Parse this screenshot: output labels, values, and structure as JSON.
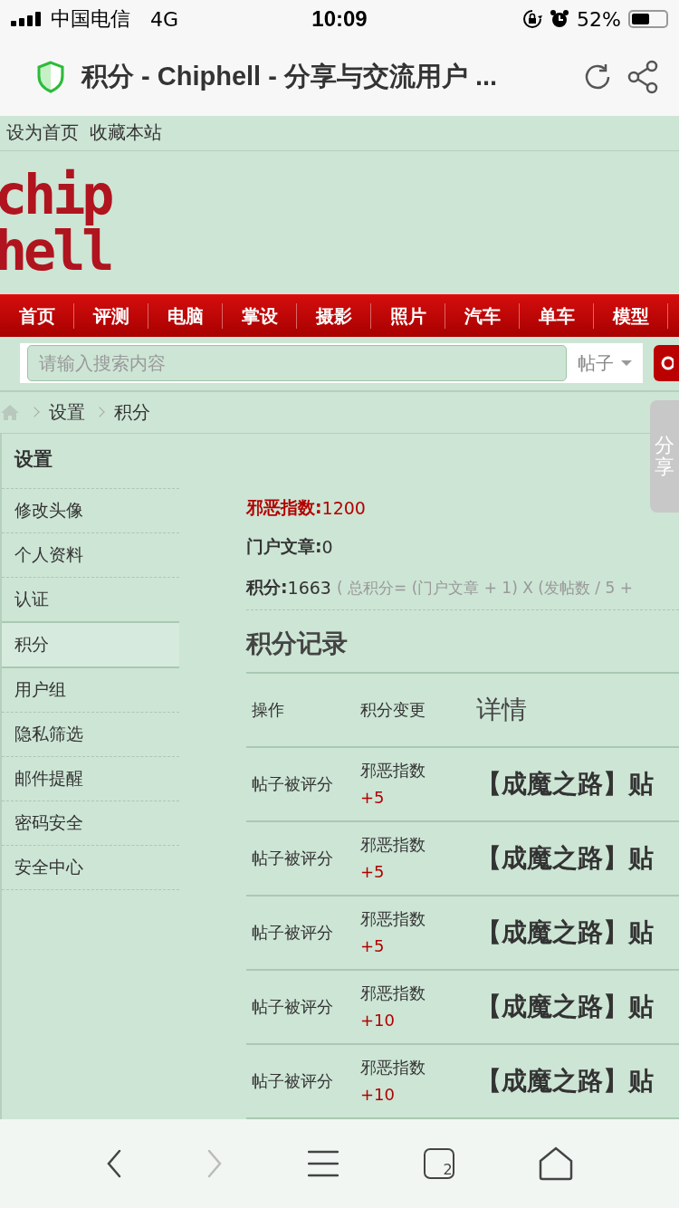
{
  "status_bar": {
    "carrier": "中国电信",
    "network": "4G",
    "time": "10:09",
    "battery": "52%"
  },
  "address_bar": {
    "title": "积分 - Chiphell - 分享与交流用户 ..."
  },
  "top_links": [
    "设为首页",
    "收藏本站"
  ],
  "logo": {
    "line_1": "chip",
    "line_2": "hell"
  },
  "nav": [
    "首页",
    "评测",
    "电脑",
    "掌设",
    "摄影",
    "照片",
    "汽车",
    "单车",
    "模型"
  ],
  "search": {
    "placeholder": "请输入搜索内容",
    "scope": "帖子"
  },
  "breadcrumb": [
    "设置",
    "积分"
  ],
  "share_tab": "分享",
  "sidebar": {
    "title": "设置",
    "items": [
      {
        "label": "修改头像",
        "selected": false
      },
      {
        "label": "个人资料",
        "selected": false
      },
      {
        "label": "认证",
        "selected": false
      },
      {
        "label": "积分",
        "selected": true
      },
      {
        "label": "用户组",
        "selected": false
      },
      {
        "label": "隐私筛选",
        "selected": false
      },
      {
        "label": "邮件提醒",
        "selected": false
      },
      {
        "label": "密码安全",
        "selected": false
      },
      {
        "label": "安全中心",
        "selected": false
      }
    ]
  },
  "stats": [
    {
      "kind": "highlight",
      "label": "邪恶指数:",
      "value": "1200"
    },
    {
      "kind": "plain",
      "label": "门户文章:",
      "value": "0"
    },
    {
      "kind": "formula",
      "label": "积分:",
      "value": "1663",
      "note": "( 总积分= (门户文章 + 1) X (发帖数 / 5 +"
    }
  ],
  "records": {
    "title": "积分记录",
    "columns": [
      "操作",
      "积分变更",
      "详情"
    ],
    "rows": [
      {
        "action": "帖子被评分",
        "change": "邪恶指数",
        "delta": "+5",
        "detail": "【成魔之路】贴"
      },
      {
        "action": "帖子被评分",
        "change": "邪恶指数",
        "delta": "+5",
        "detail": "【成魔之路】贴"
      },
      {
        "action": "帖子被评分",
        "change": "邪恶指数",
        "delta": "+5",
        "detail": "【成魔之路】贴"
      },
      {
        "action": "帖子被评分",
        "change": "邪恶指数",
        "delta": "+10",
        "detail": "【成魔之路】贴"
      },
      {
        "action": "帖子被评分",
        "change": "邪恶指数",
        "delta": "+10",
        "detail": "【成魔之路】贴"
      }
    ]
  },
  "toolbar": {
    "back_disabled": false,
    "forward_disabled": true,
    "tab_count": "2"
  }
}
